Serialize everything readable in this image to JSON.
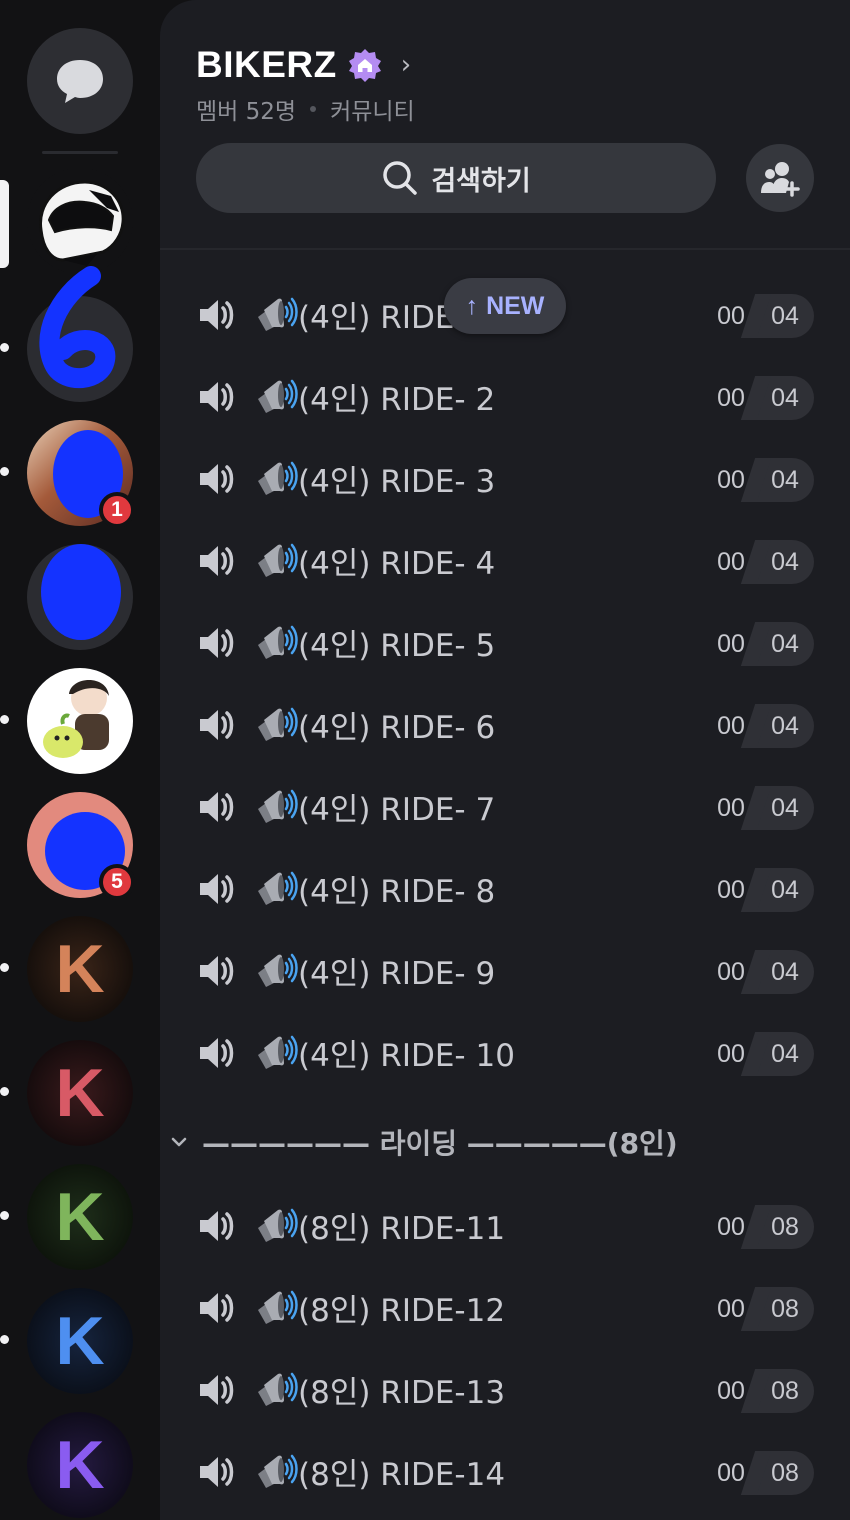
{
  "server": {
    "name": "BIKERZ",
    "members": "멤버 52명",
    "type": "커뮤니티"
  },
  "search": {
    "label": "검색하기"
  },
  "new_pill": {
    "label": "NEW",
    "arrow": "↑"
  },
  "category": {
    "label": "—————— 라이딩 —————(8인)"
  },
  "channels": [
    {
      "name": "(4인) RIDE- 1",
      "current": "00",
      "max": "04"
    },
    {
      "name": "(4인) RIDE- 2",
      "current": "00",
      "max": "04"
    },
    {
      "name": "(4인) RIDE- 3",
      "current": "00",
      "max": "04"
    },
    {
      "name": "(4인) RIDE- 4",
      "current": "00",
      "max": "04"
    },
    {
      "name": "(4인) RIDE- 5",
      "current": "00",
      "max": "04"
    },
    {
      "name": "(4인) RIDE- 6",
      "current": "00",
      "max": "04"
    },
    {
      "name": "(4인) RIDE- 7",
      "current": "00",
      "max": "04"
    },
    {
      "name": "(4인) RIDE- 8",
      "current": "00",
      "max": "04"
    },
    {
      "name": "(4인) RIDE- 9",
      "current": "00",
      "max": "04"
    },
    {
      "name": "(4인) RIDE- 10",
      "current": "00",
      "max": "04"
    }
  ],
  "channels_8": [
    {
      "name": "(8인) RIDE-11",
      "current": "00",
      "max": "08"
    },
    {
      "name": "(8인) RIDE-12",
      "current": "00",
      "max": "08"
    },
    {
      "name": "(8인) RIDE-13",
      "current": "00",
      "max": "08"
    },
    {
      "name": "(8인) RIDE-14",
      "current": "00",
      "max": "08"
    }
  ],
  "rail": {
    "badges": [
      "1",
      "5"
    ],
    "k_letter": "K"
  },
  "colors": {
    "accent_new": "#a8b2ff",
    "badge_red": "#e0393e",
    "boost_purple": "#b48cf2",
    "redaction_blue": "#1433ff"
  }
}
